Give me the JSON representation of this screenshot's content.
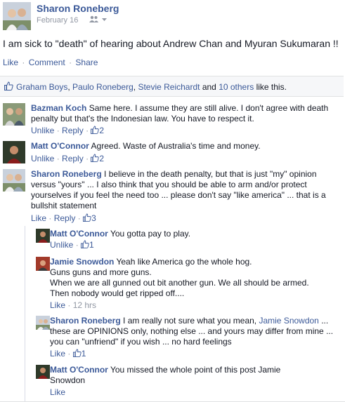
{
  "post": {
    "author": "Sharon Roneberg",
    "date": "February 16",
    "status": "I am sick to \"death\" of hearing about Andrew Chan and Myuran Sukumaran !!",
    "actions": {
      "like": "Like",
      "comment": "Comment",
      "share": "Share",
      "dot": "·"
    }
  },
  "likes": {
    "names": [
      "Graham Boys",
      "Paulo Roneberg",
      "Stevie Reichardt"
    ],
    "sep": ", ",
    "and": " and ",
    "others": "10 others",
    "suffix": " like this."
  },
  "comments": [
    {
      "author": "Bazman Koch",
      "text": "Same here. I assume they are still alive. I don't agree with death penalty but that's the Indonesian law. You have to respect it.",
      "action": "Unlike",
      "reply": "Reply",
      "likes": "2"
    },
    {
      "author": "Matt O'Connor",
      "text": "Agreed. Waste of Australia's time and money.",
      "action": "Unlike",
      "reply": "Reply",
      "likes": "2"
    },
    {
      "author": "Sharon Roneberg",
      "text": "I believe in the death penalty, but that is just \"my\" opinion versus \"yours\" ... I also think that you should be able to arm and/or protect yourselves if you feel the need too ... please don't say \"like america\" ... that is a bullshit statement",
      "action": "Like",
      "reply": "Reply",
      "likes": "3"
    }
  ],
  "replies": [
    {
      "author": "Matt O'Connor",
      "text": "You gotta pay to play.",
      "action": "Unlike",
      "likes": "1"
    },
    {
      "author": "Jamie Snowdon",
      "text": "Yeah like America go the whole hog.",
      "lines": [
        "Guns guns and more guns.",
        "When we are all gunned out bit another gun. We all should be armed.",
        "Then nobody would get ripped off...."
      ],
      "action": "Like",
      "time": "12 hrs"
    },
    {
      "author": "Sharon Roneberg",
      "text": "I am really not sure what you mean,",
      "mention": "Jamie Snowdon",
      "text2": "... these are OPINIONS only, nothing else ... and yours may differ from mine ... you can \"unfriend\" if you wish ... no hard feelings",
      "action": "Like",
      "likes": "1"
    },
    {
      "author": "Matt O'Connor",
      "text": "You missed the whole point of this post Jamie Snowdon",
      "action": "Like"
    }
  ],
  "icons": {
    "audience": "friends-icon",
    "dropdown": "caret-down-icon",
    "like": "thumbs-up-icon"
  },
  "colors": {
    "link": "#3b5998",
    "muted": "#9197a3",
    "likebar_bg": "#f6f7f9"
  }
}
